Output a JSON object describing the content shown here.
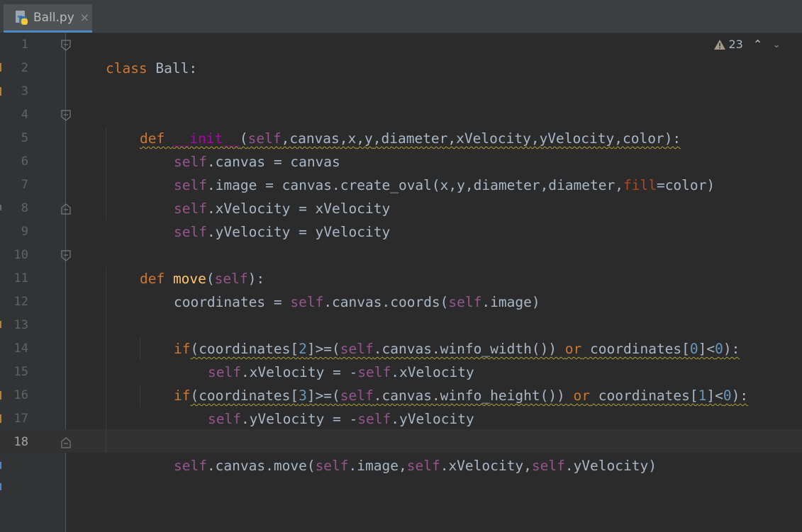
{
  "tab": {
    "label": "Ball.py",
    "close_glyph": "×",
    "icon": "python-file-icon"
  },
  "inspections": {
    "warning_count": "23",
    "icon": "warning-triangle-icon",
    "prev_glyph": "⌃",
    "next_glyph": "⌄"
  },
  "editor": {
    "current_line": 18,
    "lines": [
      {
        "num": "1"
      },
      {
        "num": "2"
      },
      {
        "num": "3"
      },
      {
        "num": "4"
      },
      {
        "num": "5"
      },
      {
        "num": "6"
      },
      {
        "num": "7"
      },
      {
        "num": "8"
      },
      {
        "num": "9"
      },
      {
        "num": "10"
      },
      {
        "num": "11"
      },
      {
        "num": "12"
      },
      {
        "num": "13"
      },
      {
        "num": "14"
      },
      {
        "num": "15"
      },
      {
        "num": "16"
      },
      {
        "num": "17"
      },
      {
        "num": "18"
      }
    ],
    "code": {
      "l1": {
        "kw": "class",
        "rest": " Ball:"
      },
      "l4": {
        "kw": "def",
        "dunder": "__init__",
        "open": "(",
        "self": "self",
        "p1": ",canvas",
        "p2": ",x",
        "p3": ",y",
        "p4": ",diameter",
        "p5": ",xVelocity",
        "p6": ",yVelocity",
        "p7": ",color",
        "close": "):"
      },
      "l5": {
        "self": "self",
        "rest": ".canvas = canvas"
      },
      "l6": {
        "self": "self",
        "a": ".image = canvas.create_oval(x",
        "b": ",y",
        "c": ",diameter",
        "d": ",diameter",
        "e": ",",
        "param": "fill",
        "f": "=color)"
      },
      "l7": {
        "self": "self",
        "rest": ".xVelocity = xVelocity"
      },
      "l8": {
        "self": "self",
        "rest": ".yVelocity = yVelocity"
      },
      "l10": {
        "kw": "def",
        "fn": " move",
        "open": "(",
        "self": "self",
        "close": "):"
      },
      "l11": {
        "a": "coordinates = ",
        "self1": "self",
        "b": ".canvas.coords(",
        "self2": "self",
        "c": ".image)"
      },
      "l13": {
        "kw": "if",
        "a": "(coordinates[",
        "n1": "2",
        "b": "]>=(",
        "self": "self",
        "c": ".canvas.winfo_width()) ",
        "or": "or",
        "d": " coordinates[",
        "n2": "0",
        "e": "]<",
        "n3": "0",
        "f": "):"
      },
      "l14": {
        "self1": "self",
        "a": ".xVelocity = -",
        "self2": "self",
        "b": ".xVelocity"
      },
      "l15": {
        "kw": "if",
        "a": "(coordinates[",
        "n1": "3",
        "b": "]>=(",
        "self": "self",
        "c": ".canvas.winfo_height()) ",
        "or": "or",
        "d": " coordinates[",
        "n2": "1",
        "e": "]<",
        "n3": "0",
        "f": "):"
      },
      "l16": {
        "self1": "self",
        "a": ".yVelocity = -",
        "self2": "self",
        "b": ".yVelocity"
      },
      "l18": {
        "self1": "self",
        "a": ".canvas.move(",
        "self2": "self",
        "b": ".image",
        "c": ",",
        "self3": "self",
        "d": ".xVelocity",
        "e": ",",
        "self4": "self",
        "f": ".yVelocity",
        "g": ")"
      }
    }
  },
  "colors": {
    "background": "#2b2b2b",
    "gutter": "#313335",
    "keyword": "#cc7832",
    "self": "#94558d",
    "function": "#ffc66d",
    "dunder": "#b200b2",
    "number": "#6897bb",
    "text": "#a9b7c6"
  }
}
